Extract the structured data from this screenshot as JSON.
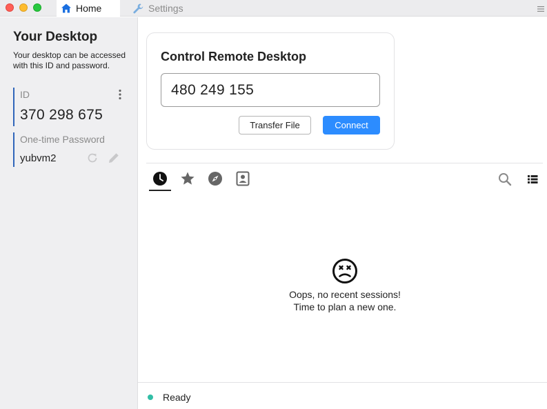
{
  "tabs": {
    "home_label": "Home",
    "settings_label": "Settings"
  },
  "left": {
    "heading": "Your Desktop",
    "description": "Your desktop can be accessed with this ID and password.",
    "id_label": "ID",
    "id_value": "370 298 675",
    "password_label": "One-time Password",
    "password_value": "yubvm2"
  },
  "connect_card": {
    "title": "Control Remote Desktop",
    "remote_id_value": "480 249 155",
    "transfer_label": "Transfer File",
    "connect_label": "Connect"
  },
  "sessions": {
    "tabs": [
      "recent-sessions",
      "favorites",
      "discovered",
      "address-book"
    ],
    "active_tab": "recent-sessions",
    "empty_line1": "Oops, no recent sessions!",
    "empty_line2": "Time to plan a new one."
  },
  "status": {
    "text": "Ready"
  },
  "colors": {
    "accent": "#2c8cff",
    "id_border": "#2f65ba",
    "status_ready": "#32bea6"
  },
  "icons": [
    "home-icon",
    "wrench-icon",
    "hamburger-menu-icon",
    "more-vertical-icon",
    "refresh-icon",
    "pencil-icon",
    "clock-icon",
    "star-icon",
    "compass-icon",
    "contact-book-icon",
    "search-icon",
    "list-view-icon",
    "sad-face-icon"
  ]
}
